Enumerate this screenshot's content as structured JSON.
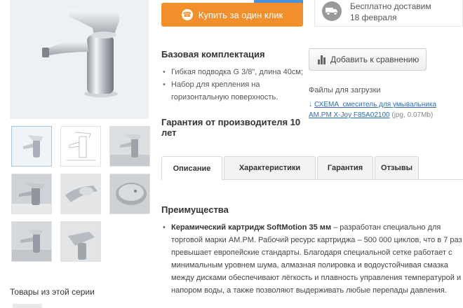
{
  "buy_button": {
    "label": "Купить за один клик",
    "icon": "phone-icon"
  },
  "delivery": {
    "title": "Бесплатно доставим",
    "date": "18 февраля",
    "icon": "truck-icon"
  },
  "kit": {
    "title": "Базовая комплектация",
    "items": [
      "Гибкая подводка G 3/8\", длина 40см;",
      "Набор для крепления на горизонтальную поверхность."
    ]
  },
  "warranty": "Гарантия от производителя 10 лет",
  "compare": {
    "label": "Добавить к сравнению",
    "icon": "bar-chart-icon"
  },
  "files": {
    "title": "Файлы для загрузки",
    "link_name": "СХЕМА_смеситель для умывальника AM.PM X-Joy F85A02100",
    "link_meta": "(jpg, 0.07Mb)",
    "icon": "download-icon"
  },
  "tabs": [
    "Описание",
    "Характеристики",
    "Гарантия",
    "Отзывы"
  ],
  "active_tab": "Описание",
  "advantages": {
    "title": "Преимущества",
    "bold": "Керамический картридж SoftMotion 35 мм",
    "text": " – разработан специально для торговой марки AM.PM. Рабочий ресурс картриджа – 500 000 циклов, что в 7 раз превышает европейские стандарты. Благодаря специальной сетке работает с минимальным уровнем шума, алмазная полировка и водоустойчивая смазка между дисками обеспечивают лёгкость и плавность управления температурой и напором воды, а также позволяют выдерживать любые перепады давления."
  },
  "series_title": "Товары из этой серии",
  "colors": {
    "accent": "#f28f2a",
    "link": "#2a6fb8",
    "thumb_active": "#a7c8e6"
  }
}
